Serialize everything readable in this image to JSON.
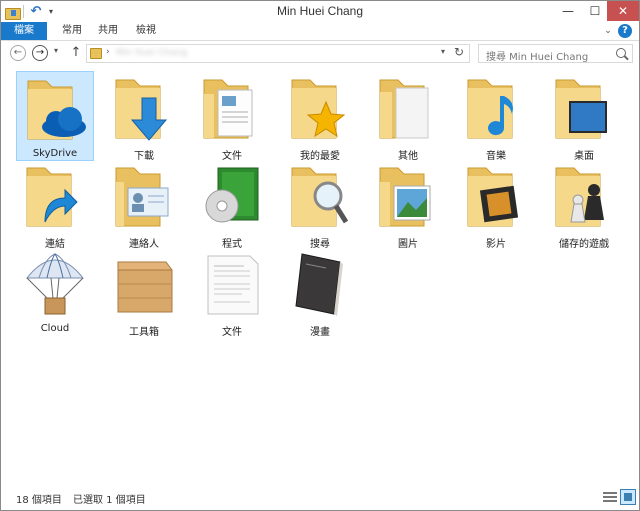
{
  "window": {
    "title": "Min Huei Chang",
    "controls": {
      "minimize": "—",
      "maximize": "☐",
      "close": "✕"
    }
  },
  "ribbon": {
    "tabs": [
      "檔案",
      "常用",
      "共用",
      "檢視"
    ],
    "help": "?"
  },
  "nav": {
    "address_text": "Min Huei Chang",
    "search_placeholder": "搜尋 Min Huei Chang"
  },
  "items": [
    {
      "label": "SkyDrive",
      "icon": "skydrive-folder-icon",
      "selected": true
    },
    {
      "label": "下載",
      "icon": "downloads-folder-icon"
    },
    {
      "label": "文件",
      "icon": "documents-folder-icon"
    },
    {
      "label": "我的最愛",
      "icon": "favorites-folder-icon"
    },
    {
      "label": "其他",
      "icon": "other-folder-icon"
    },
    {
      "label": "音樂",
      "icon": "music-folder-icon"
    },
    {
      "label": "桌面",
      "icon": "desktop-folder-icon"
    },
    {
      "label": "連結",
      "icon": "links-folder-icon"
    },
    {
      "label": "連絡人",
      "icon": "contacts-folder-icon"
    },
    {
      "label": "程式",
      "icon": "programs-icon"
    },
    {
      "label": "搜尋",
      "icon": "searches-folder-icon"
    },
    {
      "label": "圖片",
      "icon": "pictures-folder-icon"
    },
    {
      "label": "影片",
      "icon": "videos-folder-icon"
    },
    {
      "label": "儲存的遊戲",
      "icon": "saved-games-folder-icon"
    },
    {
      "label": "Cloud",
      "icon": "cloud-parachute-icon"
    },
    {
      "label": "工具箱",
      "icon": "toolbox-crate-icon"
    },
    {
      "label": "文件",
      "icon": "document-file-icon"
    },
    {
      "label": "漫畫",
      "icon": "comic-book-icon"
    }
  ],
  "status": {
    "count": "18 個項目",
    "selected": "已選取 1 個項目"
  },
  "colors": {
    "accent": "#1979ca",
    "selection_bg": "#cce8ff",
    "selection_border": "#99d1ff",
    "folder": "#f3d37a"
  }
}
